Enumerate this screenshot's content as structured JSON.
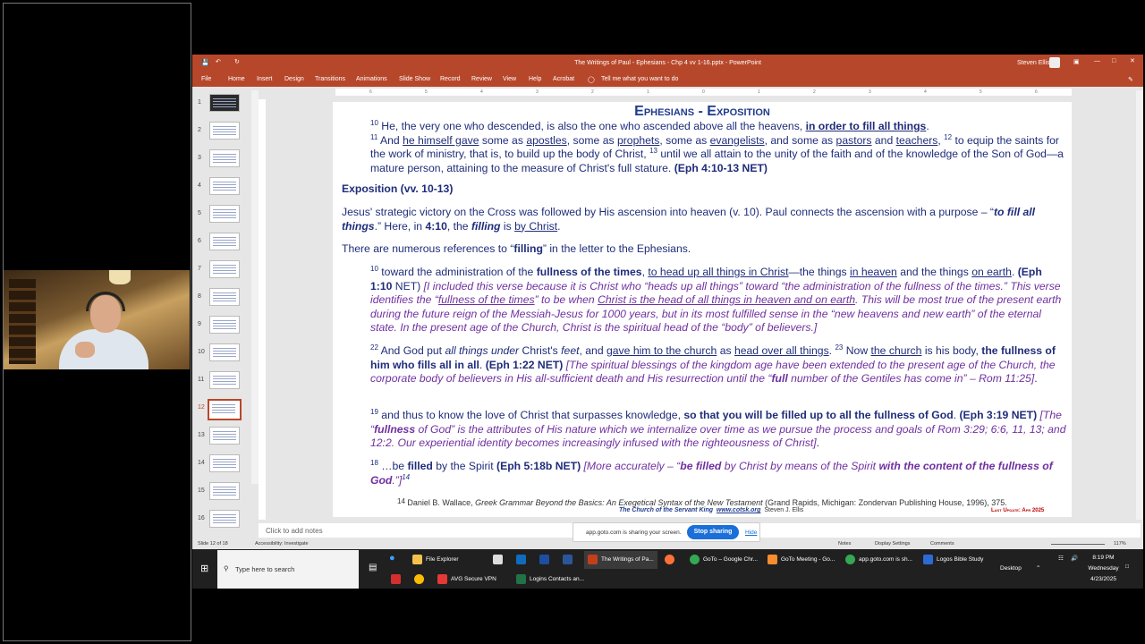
{
  "window": {
    "title": "The Writings of Paul - Ephesians - Chp 4 vv 1-16.pptx  -  PowerPoint",
    "user": "Steven Ellis"
  },
  "ribbon": {
    "tabs": [
      "File",
      "Home",
      "Insert",
      "Design",
      "Transitions",
      "Animations",
      "Slide Show",
      "Record",
      "Review",
      "View",
      "Help",
      "Acrobat"
    ],
    "tell_me": "Tell me what you want to do"
  },
  "thumbnails": [
    "1",
    "2",
    "3",
    "4",
    "5",
    "6",
    "7",
    "8",
    "9",
    "10",
    "11",
    "12",
    "13",
    "14",
    "15",
    "16"
  ],
  "ruler": [
    "6",
    "5",
    "4",
    "3",
    "2",
    "1",
    "0",
    "1",
    "2",
    "3",
    "4",
    "5",
    "6"
  ],
  "slide": {
    "heading": "Ephesians - Exposition",
    "p1": {
      "n10": "10",
      "t1": " He, the very one who descended, is also the one who ascended above all the heavens, ",
      "u1": "in order to fill all things",
      "t2": ".",
      "n11": "11",
      "t3": " And ",
      "u2": "he himself gave",
      "t4": " some as ",
      "u3": "apostles",
      "t5": ", some as ",
      "u4": "prophets",
      "t6": ", some as ",
      "u5": "evangelists",
      "t7": ", and some as ",
      "u6": "pastors",
      "t8": " and ",
      "u7": "teachers",
      "t9": ", ",
      "n12": "12",
      "t10": " to equip the saints for the work of ministry, that is, to build up the body of Christ, ",
      "n13": "13",
      "t11": " until we all attain to the unity of the faith and of the knowledge of the Son of God—a mature person, attaining to the measure of Christ's full stature.  ",
      "ref": "(Eph 4:10-13 NET)"
    },
    "exposition_label": "Exposition (vv. 10-13)",
    "p2": {
      "t1": "Jesus' strategic victory on the Cross was followed by His ascension into heaven (v. 10).  Paul connects the ascension with a purpose – “",
      "bi1": "to fill all things",
      "t2": ".”  Here, in ",
      "b1": "4:10",
      "t3": ", the ",
      "bi2": "filling",
      "t4": " is ",
      "u1": "by Christ",
      "t5": "."
    },
    "p3": {
      "t1": "There are numerous references to “",
      "b1": "filling",
      "t2": "” in the letter to the Ephesians."
    },
    "q1": {
      "n": "10",
      "t1": " toward the administration of the ",
      "b1": "fullness of the times",
      "t2": ", ",
      "u1": "to head up all things in Christ",
      "t3": "—the things ",
      "u2": "in heaven",
      "t4": " and the things ",
      "u3": "on earth",
      "t5": ".  ",
      "ref": "(Eph 1:10",
      "t6": " NET)  ",
      "c1": "[I included this verse because it is Christ who “heads up all things” toward “the administration of the fullness of the times.”  This verse identifies the “",
      "cu1": "fullness of the times",
      "c2": "” to be when ",
      "cu2": "Christ is the head of all things in heaven and on earth",
      "c3": ".  This will be most true of the present earth during the future reign of the Messiah-Jesus for 1000 years, but in its most fulfilled sense in the “new heavens and new earth” of the eternal state.  In the present age of the Church, Christ is the spiritual head of the “body” of believers.]"
    },
    "q2": {
      "n": "22",
      "t1": " And God put ",
      "i1": "all things under",
      "t2": " Christ's ",
      "i2": "feet",
      "t3": ", and ",
      "u1": "gave him to the church",
      "t4": " as ",
      "u2": "head over all things",
      "t5": ". ",
      "n2": "23",
      "t6": " Now ",
      "u3": "the church",
      "t7": " is his body, ",
      "b1": "the fullness of him who fills all in all",
      "t8": ".  ",
      "ref": "(Eph 1:22 NET)",
      "c1": " [The spiritual blessings of the kingdom age have been extended to the present age of the Church, the corporate body of believers in His all-sufficient death and His resurrection until the “",
      "cb1": "full",
      "c2": " number of the Gentiles has come in” – Rom 11:25]",
      "t9": "."
    },
    "q3": {
      "n": "19",
      "t1": " and thus to know the love of Christ that surpasses knowledge, ",
      "b1": "so that you will be filled up to all the fullness of God",
      "t2": ".  ",
      "ref": "(Eph 3:19 NET)",
      "c1": " [The “",
      "cb1": "fullness",
      "c2": " of God” is the attributes of His nature which we internalize over time as we pursue the process and goals of Rom 3:29; 6:6, 11, 13; and 12:2.  Our experiential identity becomes increasingly infused with the righteousness of Christ]",
      "t3": "."
    },
    "q4": {
      "n": "18",
      "t1": " …be ",
      "b1": "filled",
      "t2": " by the Spirit ",
      "ref": "(Eph 5:18b NET)",
      "c1": "  [More accurately – “",
      "cb1": "be filled",
      "c2": " by Christ by means of the Spirit ",
      "cb2": "with the content of the fullness of God",
      "c3": ".”]",
      "n2": "14"
    },
    "footnote": {
      "n": "14",
      "t1": " Daniel B. Wallace, ",
      "i1": "Greek Grammar Beyond the Basics: An Exegetical Syntax of the New Testament",
      "t2": " (Grand Rapids, Michigan: Zondervan Publishing House, 1996), 375."
    },
    "footer": {
      "church": "The Church of the Servant King",
      "site": "www.cotsk.org",
      "author": "Steven J. Ellis",
      "update": "Last Update: Apr 2025"
    }
  },
  "notes_placeholder": "Click to add notes",
  "status": {
    "slide": "Slide 12 of 18",
    "accessibility": "Accessibility: Investigate",
    "notes": "Notes",
    "display": "Display Settings",
    "comments": "Comments",
    "zoom": "117%"
  },
  "share": {
    "text": "app.goto.com is sharing your screen.",
    "stop": "Stop sharing",
    "hide": "Hide"
  },
  "taskbar": {
    "search": "Type here to search",
    "apps_top": [
      "File Explorer",
      "The Writings of Pa...",
      "GoTo – Google Chr...",
      "GoTo Meeting - Go...",
      "app.goto.com is sh...",
      "Logos Bible Study"
    ],
    "apps_bottom": [
      "AVG Secure VPN",
      "Logins Contacts an..."
    ],
    "desktop": "Desktop",
    "time": "8:19 PM",
    "day": "Wednesday",
    "date": "4/23/2025"
  },
  "colors": {
    "ppt_red": "#b7472a",
    "heading_blue": "#1f3b8c",
    "comment_purple": "#7030a0",
    "stop_blue": "#1a6fd8"
  }
}
